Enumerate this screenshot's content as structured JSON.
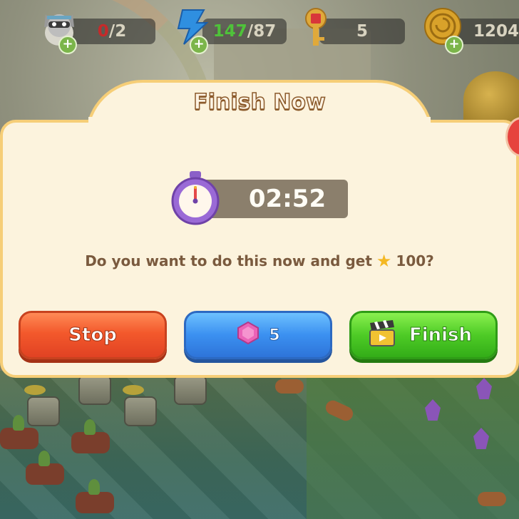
{
  "hud": {
    "pet_count_current": "0",
    "pet_count_max": "/2",
    "energy_current": "147",
    "energy_max": "/87",
    "keys": "5",
    "coins": "1204"
  },
  "dialog": {
    "title": "Finish Now",
    "timer": "02:52",
    "question_prefix": "Do you want to do this now and get",
    "reward_amount": "100?",
    "stop_label": "Stop",
    "gem_cost": "5",
    "finish_label": "Finish"
  },
  "colors": {
    "stop_button": "#f3592c",
    "gem_button": "#3b90f0",
    "finish_button": "#4ecb26",
    "dialog_bg": "#fcf3dd",
    "dialog_border": "#f6ce77"
  },
  "icons": {
    "pet": "raccoon-icon",
    "energy": "lightning-bolt-icon",
    "key": "key-icon",
    "coin": "coin-icon",
    "timer": "stopwatch-icon",
    "reward": "star-icon",
    "gem": "gem-icon",
    "finish": "clapperboard-icon"
  }
}
